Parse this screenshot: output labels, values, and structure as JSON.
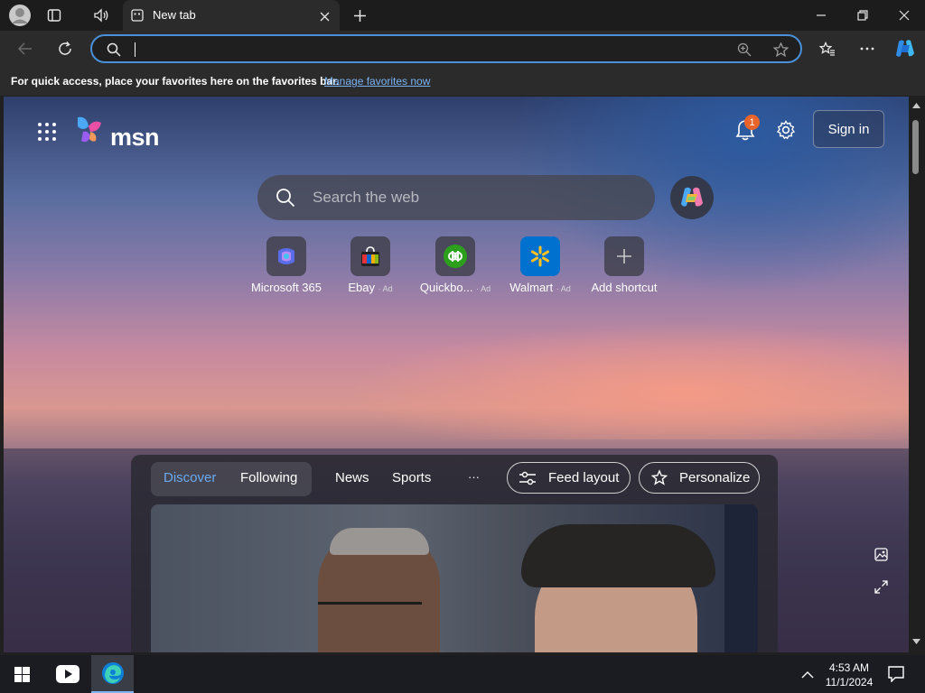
{
  "browser": {
    "tab_title": "New tab",
    "address_value": ""
  },
  "favorites_bar": {
    "message": "For quick access, place your favorites here on the favorites bar.",
    "link": "Manage favorites now"
  },
  "msn": {
    "logo_text": "msn",
    "notification_count": "1",
    "sign_in": "Sign in",
    "search_placeholder": "Search the web",
    "shortcuts": [
      {
        "label": "Microsoft 365",
        "ad": ""
      },
      {
        "label": "Ebay",
        "ad": "· Ad"
      },
      {
        "label": "Quickbo...",
        "ad": "· Ad"
      },
      {
        "label": "Walmart",
        "ad": "· Ad"
      },
      {
        "label": "Add shortcut",
        "ad": ""
      }
    ],
    "feed": {
      "tabs": [
        "Discover",
        "Following",
        "News",
        "Sports"
      ],
      "more": "···",
      "feed_layout": "Feed layout",
      "personalize": "Personalize"
    }
  },
  "taskbar": {
    "time": "4:53 AM",
    "date": "11/1/2024"
  }
}
